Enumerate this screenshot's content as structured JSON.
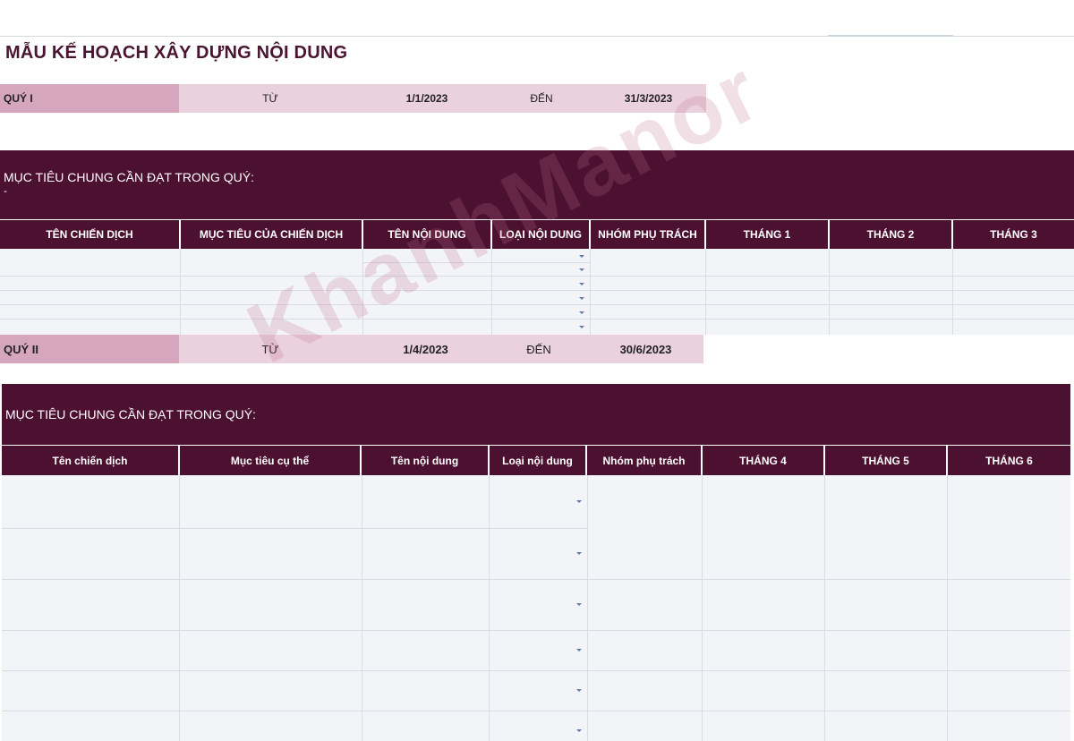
{
  "title": "MẪU KẾ HOẠCH XÂY DỰNG NỘI DUNG",
  "quarter1": {
    "label": "QUÝ I",
    "from_label": "TỪ",
    "from_date": "1/1/2023",
    "to_label": "ĐẾN",
    "to_date": "31/3/2023",
    "goal_label": "MỤC TIÊU CHUNG CẦN ĐẠT TRONG QUÝ:",
    "goal_value": "-",
    "columns": [
      "TÊN CHIẾN DỊCH",
      "MỤC TIÊU CỦA CHIẾN DỊCH",
      "TÊN NỘI DUNG",
      "LOẠI NỘI DUNG",
      "NHÓM PHỤ TRÁCH",
      "THÁNG 1",
      "THÁNG 2",
      "THÁNG 3"
    ]
  },
  "quarter2": {
    "label": "QUÝ II",
    "from_label": "TỪ",
    "from_date": "1/4/2023",
    "to_label": "ĐẾN",
    "to_date": "30/6/2023",
    "goal_label": "MỤC TIÊU CHUNG CẦN ĐẠT TRONG QUÝ:",
    "columns": [
      "Tên chiến dịch",
      "Mục tiêu cụ thể",
      "Tên nội dung",
      "Loại nội dung",
      "Nhóm phụ trách",
      "THÁNG 4",
      "THÁNG 5",
      "THÁNG 6"
    ]
  },
  "watermark": "KhanhManor",
  "colors": {
    "accent_dark": "#4c1130",
    "accent_medium": "#d5a6bd",
    "accent_light": "#ead1dc",
    "grid_bg": "#f2f4f8"
  },
  "icons": [
    "dropdown-arrow-icon"
  ]
}
